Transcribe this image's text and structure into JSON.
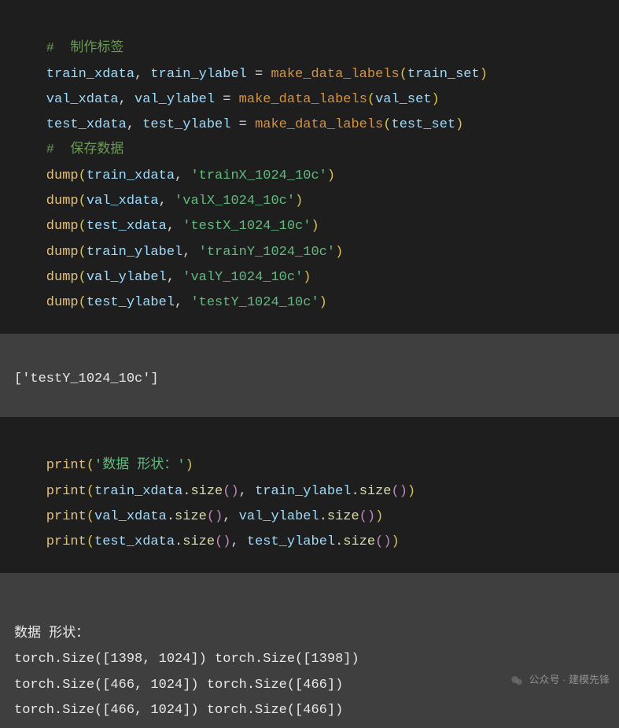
{
  "block1": {
    "comment1": "#  制作标签",
    "l1": {
      "a": "train_xdata",
      "b": "train_ylabel",
      "fn": "make_data_labels",
      "arg": "train_set"
    },
    "l2": {
      "a": "val_xdata",
      "b": "val_ylabel",
      "fn": "make_data_labels",
      "arg": "val_set"
    },
    "l3": {
      "a": "test_xdata",
      "b": "test_ylabel",
      "fn": "make_data_labels",
      "arg": "test_set"
    },
    "comment2": "#  保存数据",
    "d1": {
      "fn": "dump",
      "arg": "train_xdata",
      "str": "'trainX_1024_10c'"
    },
    "d2": {
      "fn": "dump",
      "arg": "val_xdata",
      "str": "'valX_1024_10c'"
    },
    "d3": {
      "fn": "dump",
      "arg": "test_xdata",
      "str": "'testX_1024_10c'"
    },
    "d4": {
      "fn": "dump",
      "arg": "train_ylabel",
      "str": "'trainY_1024_10c'"
    },
    "d5": {
      "fn": "dump",
      "arg": "val_ylabel",
      "str": "'valY_1024_10c'"
    },
    "d6": {
      "fn": "dump",
      "arg": "test_ylabel",
      "str": "'testY_1024_10c'"
    }
  },
  "output1": "['testY_1024_10c']",
  "block2": {
    "p0": {
      "fn": "print",
      "str": "'数据 形状：'"
    },
    "p1": {
      "fn": "print",
      "a": "train_xdata",
      "b": "train_ylabel",
      "m": "size"
    },
    "p2": {
      "fn": "print",
      "a": "val_xdata",
      "b": "val_ylabel",
      "m": "size"
    },
    "p3": {
      "fn": "print",
      "a": "test_xdata",
      "b": "test_ylabel",
      "m": "size"
    }
  },
  "output2": {
    "l1": "数据 形状：",
    "l2": "torch.Size([1398, 1024]) torch.Size([1398])",
    "l3": "torch.Size([466, 1024]) torch.Size([466])",
    "l4": "torch.Size([466, 1024]) torch.Size([466])"
  },
  "watermark": "公众号 · 建模先锋"
}
